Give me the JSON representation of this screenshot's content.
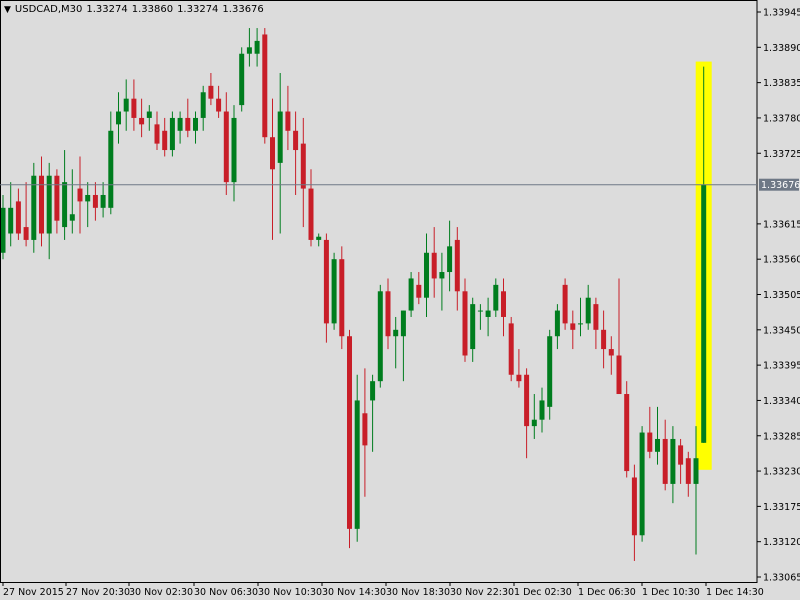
{
  "header": {
    "symbol": "USDCAD,M30",
    "open": "1.33274",
    "high": "1.33860",
    "low": "1.33274",
    "close": "1.33676"
  },
  "colors": {
    "background": "#dcdcdc",
    "bull": "#007d1e",
    "bear": "#c81e28",
    "highlight": "#ffff00",
    "price_line": "#6e7886"
  },
  "chart_data": {
    "type": "candlestick",
    "y_ticks": [
      "1.33945",
      "1.33890",
      "1.33835",
      "1.33780",
      "1.33725",
      "1.33615",
      "1.33560",
      "1.33505",
      "1.33450",
      "1.33395",
      "1.33340",
      "1.33285",
      "1.33230",
      "1.33175",
      "1.33120",
      "1.33065"
    ],
    "ylim": [
      1.33065,
      1.33945
    ],
    "x_labels": [
      "27 Nov 2015",
      "27 Nov 20:30",
      "30 Nov 02:30",
      "30 Nov 06:30",
      "30 Nov 10:30",
      "30 Nov 14:30",
      "30 Nov 18:30",
      "30 Nov 22:30",
      "1 Dec 02:30",
      "1 Dec 06:30",
      "1 Dec 10:30",
      "1 Dec 14:30"
    ],
    "current_price": "1.33676",
    "grid": false,
    "candles": [
      {
        "o": 1.3357,
        "h": 1.3366,
        "l": 1.3356,
        "c": 1.3364
      },
      {
        "o": 1.336,
        "h": 1.3368,
        "l": 1.3358,
        "c": 1.3364
      },
      {
        "o": 1.3365,
        "h": 1.3367,
        "l": 1.3359,
        "c": 1.336
      },
      {
        "o": 1.3361,
        "h": 1.3368,
        "l": 1.3358,
        "c": 1.3359
      },
      {
        "o": 1.3359,
        "h": 1.3371,
        "l": 1.3357,
        "c": 1.3369
      },
      {
        "o": 1.3369,
        "h": 1.3372,
        "l": 1.3358,
        "c": 1.336
      },
      {
        "o": 1.336,
        "h": 1.3371,
        "l": 1.3356,
        "c": 1.3369
      },
      {
        "o": 1.3369,
        "h": 1.337,
        "l": 1.336,
        "c": 1.3362
      },
      {
        "o": 1.3361,
        "h": 1.3373,
        "l": 1.3359,
        "c": 1.3368
      },
      {
        "o": 1.3362,
        "h": 1.337,
        "l": 1.336,
        "c": 1.3363
      },
      {
        "o": 1.3367,
        "h": 1.3372,
        "l": 1.336,
        "c": 1.3365
      },
      {
        "o": 1.3365,
        "h": 1.3368,
        "l": 1.3361,
        "c": 1.3366
      },
      {
        "o": 1.3366,
        "h": 1.3368,
        "l": 1.3362,
        "c": 1.3364
      },
      {
        "o": 1.3364,
        "h": 1.3368,
        "l": 1.33625,
        "c": 1.3366
      },
      {
        "o": 1.3364,
        "h": 1.3379,
        "l": 1.3363,
        "c": 1.3376
      },
      {
        "o": 1.3377,
        "h": 1.3382,
        "l": 1.3374,
        "c": 1.3379
      },
      {
        "o": 1.3379,
        "h": 1.3384,
        "l": 1.3376,
        "c": 1.3381
      },
      {
        "o": 1.3381,
        "h": 1.3384,
        "l": 1.3376,
        "c": 1.3378
      },
      {
        "o": 1.3378,
        "h": 1.3381,
        "l": 1.3375,
        "c": 1.3377
      },
      {
        "o": 1.3378,
        "h": 1.338,
        "l": 1.3376,
        "c": 1.3379
      },
      {
        "o": 1.3377,
        "h": 1.3379,
        "l": 1.3373,
        "c": 1.3374
      },
      {
        "o": 1.3376,
        "h": 1.3378,
        "l": 1.3372,
        "c": 1.3373
      },
      {
        "o": 1.3373,
        "h": 1.3379,
        "l": 1.3372,
        "c": 1.3378
      },
      {
        "o": 1.3376,
        "h": 1.3379,
        "l": 1.3374,
        "c": 1.3378
      },
      {
        "o": 1.3378,
        "h": 1.3381,
        "l": 1.3375,
        "c": 1.3376
      },
      {
        "o": 1.3376,
        "h": 1.3379,
        "l": 1.3374,
        "c": 1.3378
      },
      {
        "o": 1.3378,
        "h": 1.3383,
        "l": 1.3376,
        "c": 1.3382
      },
      {
        "o": 1.3383,
        "h": 1.3385,
        "l": 1.338,
        "c": 1.3381
      },
      {
        "o": 1.3381,
        "h": 1.3383,
        "l": 1.3378,
        "c": 1.3379
      },
      {
        "o": 1.3379,
        "h": 1.3382,
        "l": 1.3366,
        "c": 1.3368
      },
      {
        "o": 1.3368,
        "h": 1.338,
        "l": 1.3365,
        "c": 1.3378
      },
      {
        "o": 1.338,
        "h": 1.3389,
        "l": 1.3379,
        "c": 1.3388
      },
      {
        "o": 1.3388,
        "h": 1.3392,
        "l": 1.3386,
        "c": 1.3389
      },
      {
        "o": 1.3388,
        "h": 1.3392,
        "l": 1.3386,
        "c": 1.339
      },
      {
        "o": 1.3391,
        "h": 1.3392,
        "l": 1.3374,
        "c": 1.3375
      },
      {
        "o": 1.3375,
        "h": 1.3381,
        "l": 1.3359,
        "c": 1.337
      },
      {
        "o": 1.3371,
        "h": 1.3385,
        "l": 1.336,
        "c": 1.3379
      },
      {
        "o": 1.3379,
        "h": 1.3383,
        "l": 1.3373,
        "c": 1.3376
      },
      {
        "o": 1.3376,
        "h": 1.3379,
        "l": 1.3366,
        "c": 1.3373
      },
      {
        "o": 1.3374,
        "h": 1.3378,
        "l": 1.3361,
        "c": 1.3367
      },
      {
        "o": 1.3367,
        "h": 1.337,
        "l": 1.3358,
        "c": 1.3359
      },
      {
        "o": 1.3359,
        "h": 1.336,
        "l": 1.3358,
        "c": 1.33595
      },
      {
        "o": 1.3359,
        "h": 1.336,
        "l": 1.3343,
        "c": 1.3346
      },
      {
        "o": 1.3346,
        "h": 1.3357,
        "l": 1.3345,
        "c": 1.3356
      },
      {
        "o": 1.3356,
        "h": 1.3358,
        "l": 1.3342,
        "c": 1.3344
      },
      {
        "o": 1.3344,
        "h": 1.3345,
        "l": 1.3311,
        "c": 1.3314
      },
      {
        "o": 1.3314,
        "h": 1.3338,
        "l": 1.3312,
        "c": 1.3334
      },
      {
        "o": 1.3332,
        "h": 1.3339,
        "l": 1.3319,
        "c": 1.3327
      },
      {
        "o": 1.3334,
        "h": 1.3338,
        "l": 1.3326,
        "c": 1.3337
      },
      {
        "o": 1.3337,
        "h": 1.3352,
        "l": 1.3336,
        "c": 1.3351
      },
      {
        "o": 1.3351,
        "h": 1.3353,
        "l": 1.3342,
        "c": 1.3344
      },
      {
        "o": 1.3344,
        "h": 1.3347,
        "l": 1.3339,
        "c": 1.3345
      },
      {
        "o": 1.3344,
        "h": 1.3348,
        "l": 1.3337,
        "c": 1.3348
      },
      {
        "o": 1.3348,
        "h": 1.3354,
        "l": 1.3347,
        "c": 1.3353
      },
      {
        "o": 1.3352,
        "h": 1.3354,
        "l": 1.3349,
        "c": 1.335
      },
      {
        "o": 1.335,
        "h": 1.336,
        "l": 1.3347,
        "c": 1.3357
      },
      {
        "o": 1.3357,
        "h": 1.3361,
        "l": 1.335,
        "c": 1.3353
      },
      {
        "o": 1.3353,
        "h": 1.3357,
        "l": 1.3348,
        "c": 1.3354
      },
      {
        "o": 1.3354,
        "h": 1.3362,
        "l": 1.3351,
        "c": 1.3358
      },
      {
        "o": 1.3359,
        "h": 1.3361,
        "l": 1.3348,
        "c": 1.3351
      },
      {
        "o": 1.3351,
        "h": 1.3353,
        "l": 1.334,
        "c": 1.3341
      },
      {
        "o": 1.3342,
        "h": 1.335,
        "l": 1.334,
        "c": 1.3349
      },
      {
        "o": 1.3348,
        "h": 1.3349,
        "l": 1.3345,
        "c": 1.3348
      },
      {
        "o": 1.3347,
        "h": 1.335,
        "l": 1.3344,
        "c": 1.3348
      },
      {
        "o": 1.3348,
        "h": 1.3353,
        "l": 1.3347,
        "c": 1.3352
      },
      {
        "o": 1.3351,
        "h": 1.3353,
        "l": 1.3344,
        "c": 1.3347
      },
      {
        "o": 1.3346,
        "h": 1.3347,
        "l": 1.3337,
        "c": 1.3338
      },
      {
        "o": 1.3338,
        "h": 1.3342,
        "l": 1.3336,
        "c": 1.3337
      },
      {
        "o": 1.3338,
        "h": 1.3339,
        "l": 1.3325,
        "c": 1.333
      },
      {
        "o": 1.333,
        "h": 1.3335,
        "l": 1.3328,
        "c": 1.3331
      },
      {
        "o": 1.3331,
        "h": 1.3336,
        "l": 1.3329,
        "c": 1.3334
      },
      {
        "o": 1.3333,
        "h": 1.3345,
        "l": 1.3331,
        "c": 1.3344
      },
      {
        "o": 1.3344,
        "h": 1.3349,
        "l": 1.3342,
        "c": 1.3348
      },
      {
        "o": 1.3352,
        "h": 1.3353,
        "l": 1.3345,
        "c": 1.3346
      },
      {
        "o": 1.3346,
        "h": 1.3348,
        "l": 1.3342,
        "c": 1.3345
      },
      {
        "o": 1.3346,
        "h": 1.335,
        "l": 1.3344,
        "c": 1.3346
      },
      {
        "o": 1.3346,
        "h": 1.3352,
        "l": 1.3345,
        "c": 1.335
      },
      {
        "o": 1.3349,
        "h": 1.335,
        "l": 1.3342,
        "c": 1.3345
      },
      {
        "o": 1.3345,
        "h": 1.3348,
        "l": 1.3339,
        "c": 1.3342
      },
      {
        "o": 1.3342,
        "h": 1.3344,
        "l": 1.3338,
        "c": 1.3341
      },
      {
        "o": 1.3341,
        "h": 1.3353,
        "l": 1.3336,
        "c": 1.3335
      },
      {
        "o": 1.3335,
        "h": 1.3337,
        "l": 1.3322,
        "c": 1.3323
      },
      {
        "o": 1.3322,
        "h": 1.3324,
        "l": 1.3309,
        "c": 1.3313
      },
      {
        "o": 1.3313,
        "h": 1.333,
        "l": 1.3312,
        "c": 1.3329
      },
      {
        "o": 1.3329,
        "h": 1.3333,
        "l": 1.3325,
        "c": 1.3326
      },
      {
        "o": 1.3326,
        "h": 1.3333,
        "l": 1.3324,
        "c": 1.3328
      },
      {
        "o": 1.3328,
        "h": 1.3331,
        "l": 1.332,
        "c": 1.3321
      },
      {
        "o": 1.3321,
        "h": 1.333,
        "l": 1.3318,
        "c": 1.3328
      },
      {
        "o": 1.3327,
        "h": 1.3328,
        "l": 1.3321,
        "c": 1.3324
      },
      {
        "o": 1.3325,
        "h": 1.3326,
        "l": 1.3319,
        "c": 1.3321
      },
      {
        "o": 1.3321,
        "h": 1.333,
        "l": 1.331,
        "c": 1.3325
      },
      {
        "o": 1.33274,
        "h": 1.3386,
        "l": 1.33274,
        "c": 1.33676
      }
    ]
  }
}
